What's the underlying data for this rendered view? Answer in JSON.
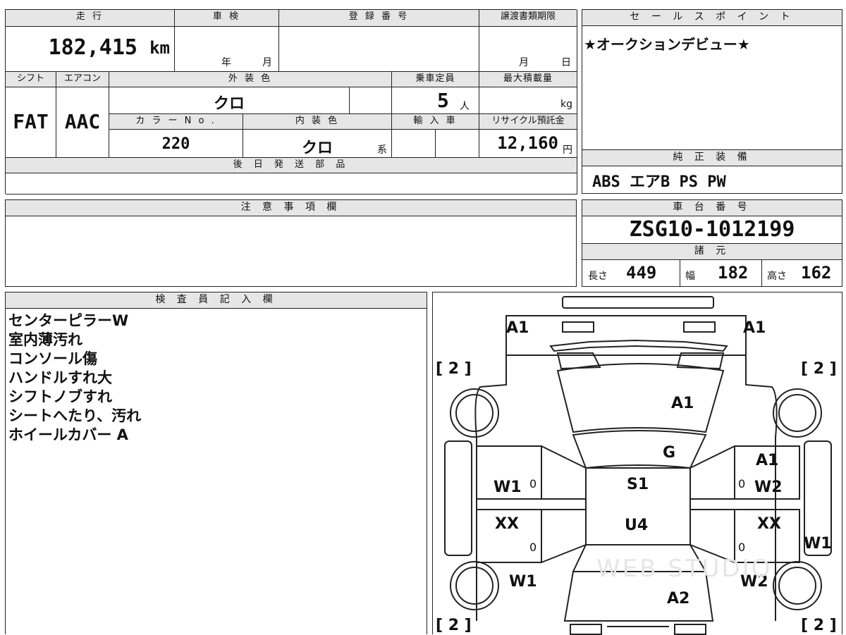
{
  "top_block": {
    "labels": {
      "mileage": "走 行",
      "inspection": "車 検",
      "registration": "登 録 番 号",
      "transfer_deadline": "譲渡書類期限",
      "shift": "シフト",
      "aircon": "エアコン",
      "exterior_color": "外 装 色",
      "capacity": "乗車定員",
      "max_load": "最大積載量",
      "color_no": "カ ラ ー N o .",
      "interior_color": "内 装 色",
      "import": "輸 入 車",
      "recycle_fee": "リサイクル預託金",
      "later_parts": "後 日 発 送 部 品"
    },
    "mileage_value": "182,415",
    "mileage_unit": "km",
    "year_unit": "年",
    "month_unit": "月",
    "deadline_month": "月",
    "deadline_day": "日",
    "shift_value": "FAT",
    "aircon_value": "AAC",
    "exterior_color_value": "クロ",
    "capacity_value": "5",
    "capacity_unit": "人",
    "max_load_unit": "kg",
    "color_no_value": "220",
    "interior_color_value": "クロ",
    "interior_suffix": "系",
    "recycle_value": "12,160",
    "recycle_unit": "円"
  },
  "sales_point": {
    "label": "セ ー ル ス ポ イ ン ト",
    "text": "★オークションデビュー★"
  },
  "equipment": {
    "label": "純 正 装 備",
    "text": "ABS エアB PS PW"
  },
  "notes": {
    "label": "注 意 事 項 欄"
  },
  "chassis": {
    "label": "車 台 番 号",
    "value": "ZSG10-1012199",
    "spec_label": "諸 元",
    "length_label": "長さ",
    "length_value": "449",
    "width_label": "幅",
    "width_value": "182",
    "height_label": "高さ",
    "height_value": "162"
  },
  "inspector": {
    "label": "検 査 員 記 入 欄",
    "lines": [
      "センターピラーW",
      "室内薄汚れ",
      "コンソール傷",
      "ハンドルすれ大",
      "シフトノブすれ",
      "シートへたり、汚れ",
      "ホイールカバー A"
    ]
  },
  "diagram": {
    "marks": {
      "front_left": "A1",
      "front_right": "A1",
      "hood": "A1",
      "windshield": "G",
      "roof": "S1",
      "roof_lower": "U4",
      "rear": "A2",
      "left_front_door": "W1",
      "left_rear_door": "XX",
      "left_rear_fender": "W1",
      "right_front_fender": "A1",
      "right_front_door": "W2",
      "right_rear_door": "XX",
      "right_side": "W1",
      "right_rear_fender": "W2",
      "zero": "0",
      "tire_tl": "[ 2 ]",
      "tire_tr": "[ 2 ]",
      "tire_bl": "[ 2 ]",
      "tire_br": "[ 2 ]",
      "watermark": "WEB STUDIO"
    }
  }
}
